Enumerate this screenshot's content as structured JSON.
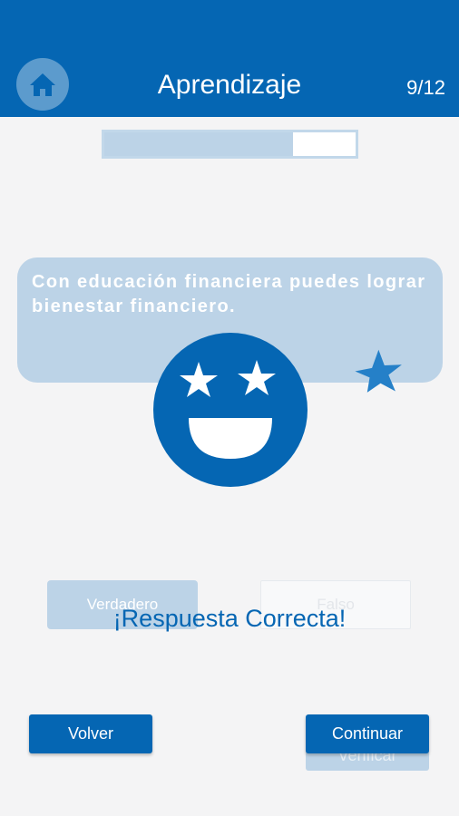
{
  "header": {
    "title": "Aprendizaje",
    "counter": "9/12",
    "home_icon": "home-icon",
    "background_color": "#0566b3"
  },
  "progress": {
    "fraction": 0.75
  },
  "question": {
    "text": "Con educación financiera puedes lograr bienestar financiero."
  },
  "options": {
    "true_label": "Verdadero",
    "false_label": "Falso"
  },
  "feedback": {
    "text": "¡Respuesta Correcta!",
    "icon": "star-eyes-smiley-icon",
    "decor_icon": "star-icon"
  },
  "buttons": {
    "back_label": "Volver",
    "verify_label": "Verificar",
    "continue_label": "Continuar"
  },
  "colors": {
    "accent": "#0566b3",
    "muted": "#bcd3e7",
    "background": "#f4f4f5"
  }
}
